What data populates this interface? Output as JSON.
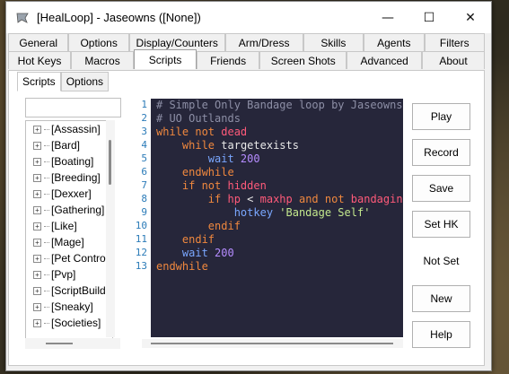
{
  "window": {
    "title": "[HealLoop] - Jaseowns ([None])"
  },
  "tabs_row1": [
    "General",
    "Options",
    "Display/Counters",
    "Arm/Dress",
    "Skills",
    "Agents",
    "Filters"
  ],
  "tabs_row2": [
    "Hot Keys",
    "Macros",
    "Scripts",
    "Friends",
    "Screen Shots",
    "Advanced",
    "About"
  ],
  "active_tab": "Scripts",
  "subtabs": [
    "Scripts",
    "Options"
  ],
  "tree_items": [
    "[Assassin]",
    "[Bard]",
    "[Boating]",
    "[Breeding]",
    "[Dexxer]",
    "[Gathering]",
    "[Like]",
    "[Mage]",
    "[Pet Control",
    "[Pvp]",
    "[ScriptBuilde",
    "[Sneaky]",
    "[Societies]"
  ],
  "line_numbers": [
    "1",
    "2",
    "3",
    "4",
    "5",
    "6",
    "7",
    "8",
    "9",
    "10",
    "11",
    "12",
    "13"
  ],
  "code_lines": [
    [
      {
        "c": "cmt",
        "t": "# Simple Only Bandage loop by Jaseowns"
      }
    ],
    [
      {
        "c": "cmt",
        "t": "# UO Outlands"
      }
    ],
    [
      {
        "c": "kw",
        "t": "while not "
      },
      {
        "c": "var",
        "t": "dead"
      }
    ],
    [
      {
        "c": "",
        "t": "    "
      },
      {
        "c": "kw",
        "t": "while "
      },
      {
        "c": "",
        "t": "targetexists"
      }
    ],
    [
      {
        "c": "",
        "t": "        "
      },
      {
        "c": "fn",
        "t": "wait "
      },
      {
        "c": "num",
        "t": "200"
      }
    ],
    [
      {
        "c": "",
        "t": "    "
      },
      {
        "c": "kw",
        "t": "endwhile"
      }
    ],
    [
      {
        "c": "",
        "t": "    "
      },
      {
        "c": "kw",
        "t": "if not "
      },
      {
        "c": "var",
        "t": "hidden"
      }
    ],
    [
      {
        "c": "",
        "t": "        "
      },
      {
        "c": "kw",
        "t": "if "
      },
      {
        "c": "var",
        "t": "hp "
      },
      {
        "c": "",
        "t": "< "
      },
      {
        "c": "var",
        "t": "maxhp "
      },
      {
        "c": "kw",
        "t": "and not "
      },
      {
        "c": "var",
        "t": "bandaging"
      }
    ],
    [
      {
        "c": "",
        "t": "            "
      },
      {
        "c": "fn",
        "t": "hotkey "
      },
      {
        "c": "str",
        "t": "'Bandage Self'"
      }
    ],
    [
      {
        "c": "",
        "t": "        "
      },
      {
        "c": "kw",
        "t": "endif"
      }
    ],
    [
      {
        "c": "",
        "t": "    "
      },
      {
        "c": "kw",
        "t": "endif"
      }
    ],
    [
      {
        "c": "",
        "t": "    "
      },
      {
        "c": "fn",
        "t": "wait "
      },
      {
        "c": "num",
        "t": "200"
      }
    ],
    [
      {
        "c": "kw",
        "t": "endwhile"
      }
    ]
  ],
  "buttons": {
    "play": "Play",
    "record": "Record",
    "save": "Save",
    "set_hk": "Set HK",
    "hotkey_status": "Not Set",
    "new": "New",
    "help": "Help"
  },
  "window_controls": {
    "minimize": "—",
    "maximize": "☐",
    "close": "✕"
  }
}
